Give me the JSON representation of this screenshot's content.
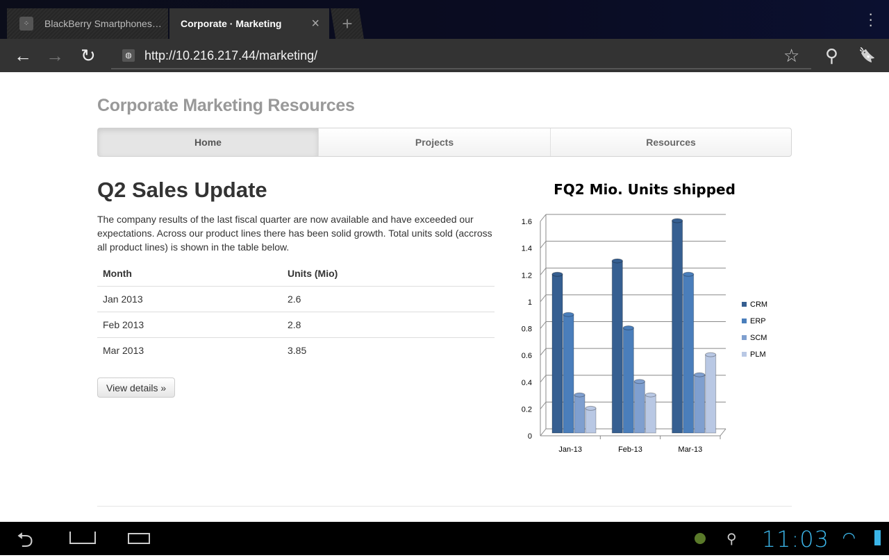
{
  "browser": {
    "tabs": [
      {
        "label": "BlackBerry Smartphones…",
        "icon": "blackberry-icon"
      },
      {
        "label": "Corporate · Marketing",
        "active": true,
        "close": "×"
      }
    ],
    "new_tab": "+",
    "menu": "⋮",
    "back": "←",
    "forward": "→",
    "reload": "↻",
    "url": "http://10.216.217.44/marketing/",
    "star": "☆",
    "search": "⚲",
    "bookmarks": "🔖"
  },
  "site": {
    "brand": "Corporate Marketing Resources",
    "nav": [
      {
        "label": "Home",
        "active": true
      },
      {
        "label": "Projects"
      },
      {
        "label": "Resources"
      }
    ],
    "heading": "Q2 Sales Update",
    "paragraph": "The company results of the last fiscal quarter are now available and have exceeded our expectations. Across our product lines there has been solid growth. Total units sold (accross all product lines) is shown in the table below.",
    "table": {
      "headers": [
        "Month",
        "Units (Mio)"
      ],
      "rows": [
        [
          "Jan 2013",
          "2.6"
        ],
        [
          "Feb 2013",
          "2.8"
        ],
        [
          "Mar 2013",
          "3.85"
        ]
      ]
    },
    "details_button": "View details »"
  },
  "chart_data": {
    "type": "bar",
    "style": "3d-cylinder-clustered",
    "title": "FQ2 Mio. Units shipped",
    "categories": [
      "Jan-13",
      "Feb-13",
      "Mar-13"
    ],
    "series": [
      {
        "name": "CRM",
        "values": [
          1.2,
          1.3,
          1.6
        ],
        "color": "#365f91"
      },
      {
        "name": "ERP",
        "values": [
          0.9,
          0.8,
          1.2
        ],
        "color": "#4a7ebb"
      },
      {
        "name": "SCM",
        "values": [
          0.3,
          0.4,
          0.45
        ],
        "color": "#7f9fcf"
      },
      {
        "name": "PLM",
        "values": [
          0.2,
          0.3,
          0.6
        ],
        "color": "#b9c8e4"
      }
    ],
    "ylim": [
      0,
      1.6
    ],
    "yticks": [
      "0",
      "0.2",
      "0.4",
      "0.6",
      "0.8",
      "1",
      "1.2",
      "1.4",
      "1.6"
    ],
    "grid": true,
    "legend": "right"
  },
  "system": {
    "clock": "11:03"
  }
}
